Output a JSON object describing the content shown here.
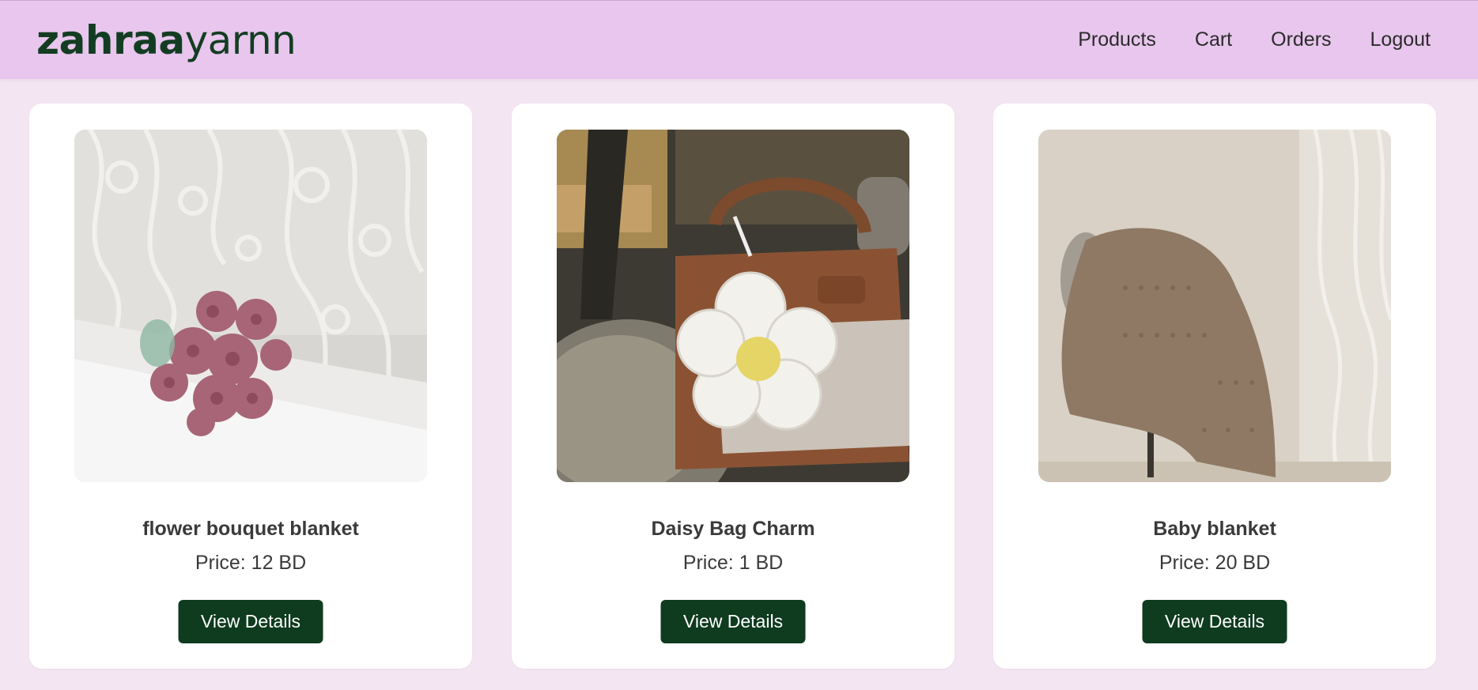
{
  "navbar": {
    "logo_bold": "zahraa",
    "logo_light": "yarnn",
    "links": [
      "Products",
      "Cart",
      "Orders",
      "Logout"
    ]
  },
  "products": [
    {
      "title": "flower bouquet blanket",
      "price": "Price: 12 BD",
      "button": "View Details",
      "image_icon": "crochet-rose-bouquet-photo"
    },
    {
      "title": "Daisy Bag Charm",
      "price": "Price: 1 BD",
      "button": "View Details",
      "image_icon": "daisy-bag-charm-photo"
    },
    {
      "title": "Baby blanket",
      "price": "Price: 20 BD",
      "button": "View Details",
      "image_icon": "baby-blanket-photo"
    }
  ],
  "colors": {
    "navbar_bg": "#e8c6ed",
    "page_bg": "#f3e6f2",
    "brand_green": "#0f3b1f",
    "card_bg": "#ffffff"
  }
}
